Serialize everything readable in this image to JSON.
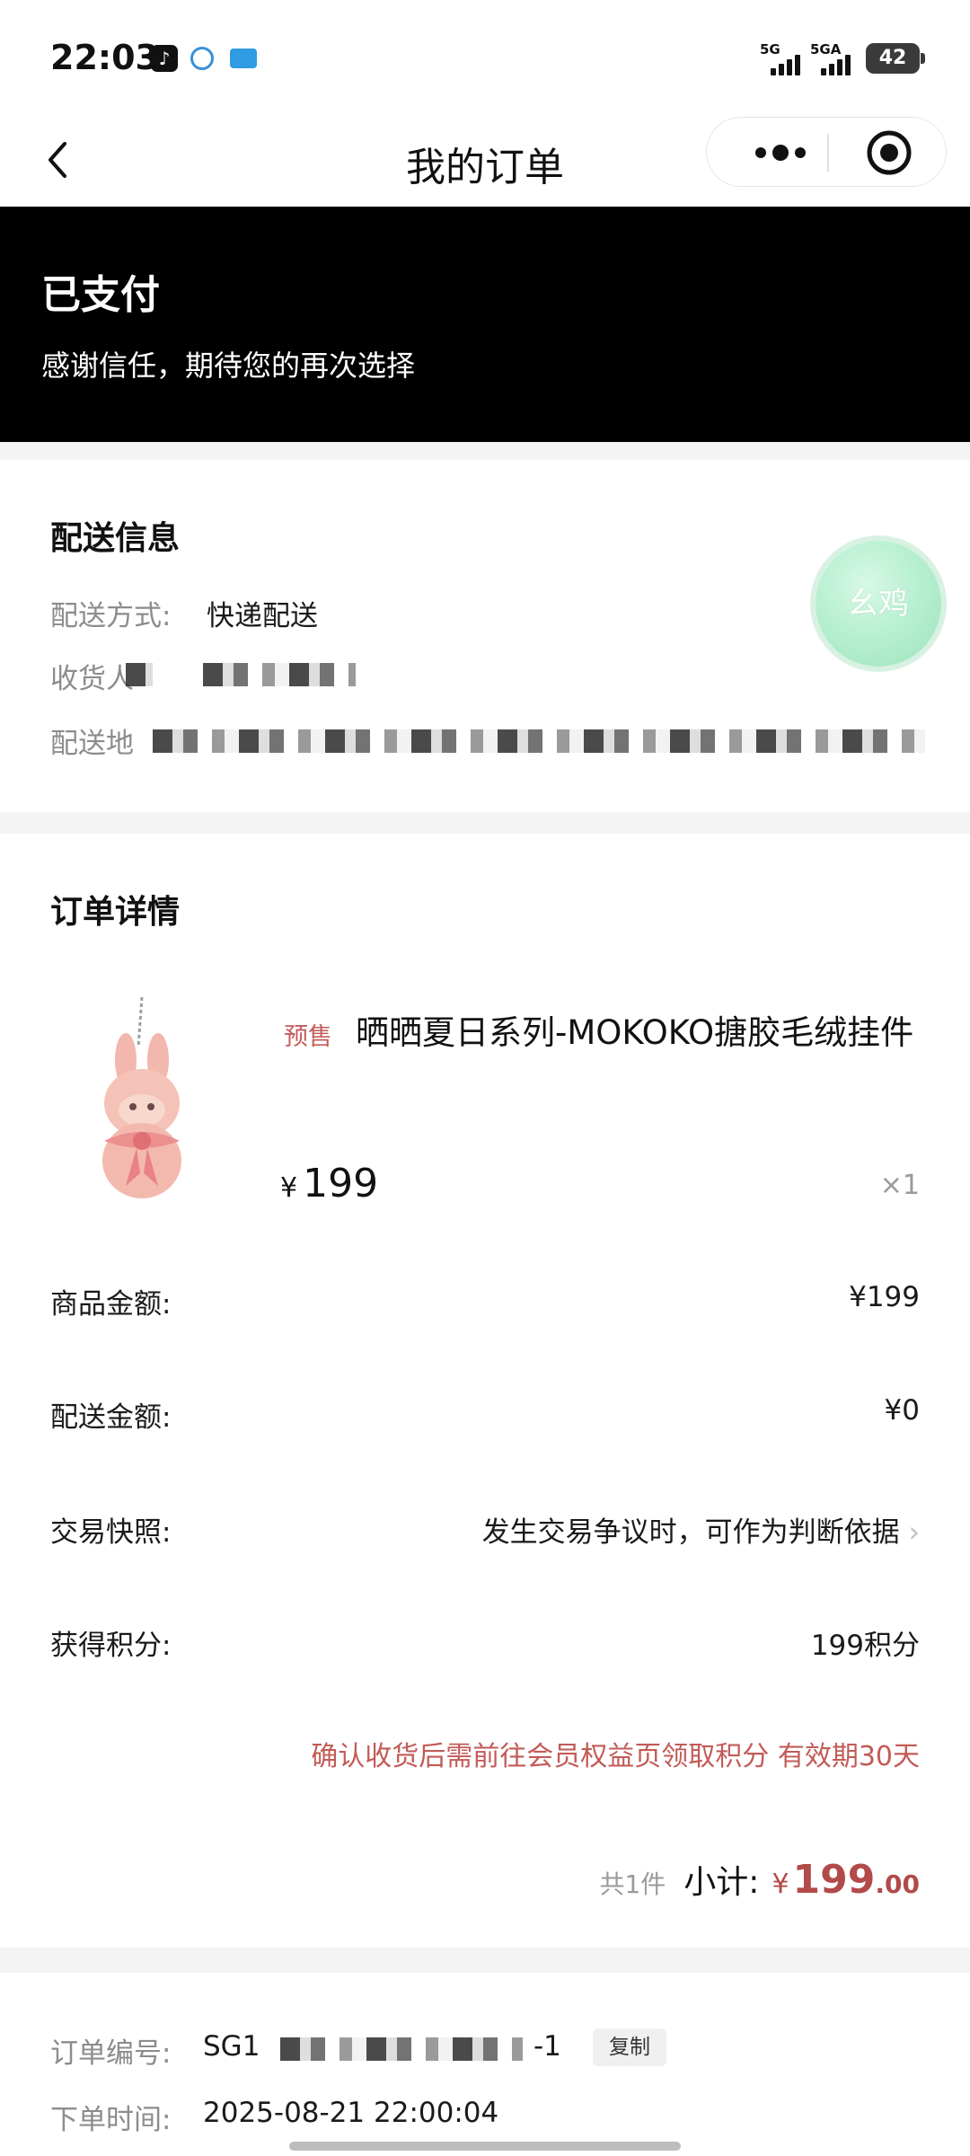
{
  "status_bar": {
    "time": "22:03",
    "signal1": "5G",
    "signal2": "5GA",
    "battery": "42"
  },
  "nav": {
    "title": "我的订单"
  },
  "banner": {
    "status_title": "已支付",
    "status_subtitle": "感谢信任，期待您的再次选择"
  },
  "delivery": {
    "title": "配送信息",
    "method_label": "配送方式:",
    "method_value": "快递配送",
    "receiver_label": "收货人",
    "address_label": "配送地"
  },
  "float_button": {
    "label": "幺鸡"
  },
  "order": {
    "title": "订单详情",
    "product": {
      "badge": "预售",
      "name": "晒晒夏日系列-MOKOKO搪胶毛绒挂件",
      "currency": "¥",
      "price": "199",
      "quantity": "×1"
    },
    "lines": [
      {
        "label": "商品金额:",
        "value": "¥199"
      },
      {
        "label": "配送金额:",
        "value": "¥0"
      },
      {
        "label": "交易快照:",
        "value": "发生交易争议时，可作为判断依据"
      },
      {
        "label": "获得积分:",
        "value": "199积分"
      }
    ],
    "points_note": "确认收货后需前往会员权益页领取积分 有效期30天",
    "subtotal": {
      "count": "共1件",
      "label": "小计:",
      "currency": "¥",
      "amount": "199",
      "decimal": ".00"
    }
  },
  "meta": {
    "order_no_label": "订单编号:",
    "order_no_prefix": "SG1",
    "order_no_suffix": "-1",
    "copy_label": "复制",
    "time_label": "下单时间:",
    "time_value": "2025-08-21 22:00:04"
  },
  "colors": {
    "accent_red": "#b24a4a",
    "banner_bg": "#000000"
  }
}
